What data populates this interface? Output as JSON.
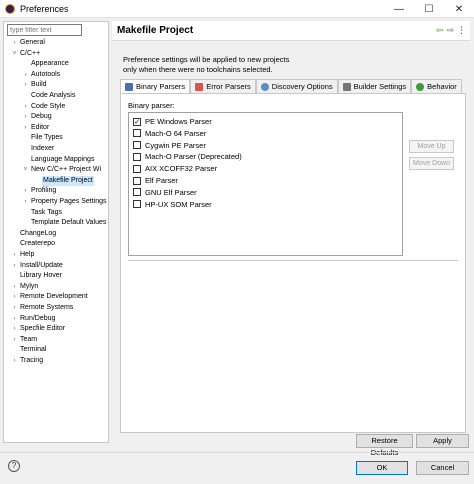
{
  "window": {
    "title": "Preferences",
    "controls": {
      "minimize": "—",
      "maximize": "☐",
      "close": "✕"
    }
  },
  "filter": {
    "placeholder": "type filter text"
  },
  "tree": [
    {
      "label": "General",
      "expand": "›",
      "expanded": false
    },
    {
      "label": "C/C++",
      "expand": "˅",
      "expanded": true
    },
    {
      "label": "Appearance"
    },
    {
      "label": "Autotools",
      "expand": "›"
    },
    {
      "label": "Build",
      "expand": "›"
    },
    {
      "label": "Code Analysis"
    },
    {
      "label": "Code Style",
      "expand": "›"
    },
    {
      "label": "Debug",
      "expand": "›"
    },
    {
      "label": "Editor",
      "expand": "›"
    },
    {
      "label": "File Types"
    },
    {
      "label": "Indexer"
    },
    {
      "label": "Language Mappings"
    },
    {
      "label": "New C/C++ Project Wi",
      "expand": "˅"
    },
    {
      "label": "Makefile Project",
      "selected": true
    },
    {
      "label": "Profiling",
      "expand": "›"
    },
    {
      "label": "Property Pages Settings",
      "expand": "›"
    },
    {
      "label": "Task Tags"
    },
    {
      "label": "Template Default Values"
    },
    {
      "label": "ChangeLog"
    },
    {
      "label": "Createrepo"
    },
    {
      "label": "Help",
      "expand": "›"
    },
    {
      "label": "Install/Update",
      "expand": "›"
    },
    {
      "label": "Library Hover"
    },
    {
      "label": "Mylyn",
      "expand": "›"
    },
    {
      "label": "Remote Development",
      "expand": "›"
    },
    {
      "label": "Remote Systems",
      "expand": "›"
    },
    {
      "label": "Run/Debug",
      "expand": "›"
    },
    {
      "label": "Specfile Editor",
      "expand": "›"
    },
    {
      "label": "Team",
      "expand": "›"
    },
    {
      "label": "Terminal"
    },
    {
      "label": "Tracing",
      "expand": "›"
    }
  ],
  "page": {
    "title": "Makefile Project",
    "nav": {
      "back": "⇦",
      "forward": "⇨",
      "menu": "⋮"
    },
    "info_line1": "Preference settings will be applied to new projects",
    "info_line2": "only when there were no toolchains selected."
  },
  "tabs": [
    {
      "label": "Binary Parsers",
      "icon": "binary-parsers-icon",
      "color": "#4a6fb5",
      "active": true
    },
    {
      "label": "Error Parsers",
      "icon": "error-parsers-icon",
      "color": "#d9534f"
    },
    {
      "label": "Discovery Options",
      "icon": "discovery-icon",
      "color": "#5a8dc8"
    },
    {
      "label": "Builder Settings",
      "icon": "builder-icon",
      "color": "#777777"
    },
    {
      "label": "Behavior",
      "icon": "behavior-icon",
      "color": "#3c9a3c"
    }
  ],
  "binary_parsers": {
    "group_label": "Binary parser:",
    "items": [
      {
        "label": "PE Windows Parser",
        "checked": true
      },
      {
        "label": "Mach-O 64 Parser",
        "checked": false
      },
      {
        "label": "Cygwin PE Parser",
        "checked": false
      },
      {
        "label": "Mach-O Parser (Deprecated)",
        "checked": false
      },
      {
        "label": "AIX XCOFF32 Parser",
        "checked": false
      },
      {
        "label": "Elf Parser",
        "checked": false
      },
      {
        "label": "GNU Elf Parser",
        "checked": false
      },
      {
        "label": "HP-UX SOM Parser",
        "checked": false
      }
    ],
    "move_up": "Move Up",
    "move_down": "Move Down"
  },
  "buttons": {
    "restore_defaults": "Restore Defaults",
    "apply": "Apply",
    "ok": "OK",
    "cancel": "Cancel",
    "help": "?"
  }
}
